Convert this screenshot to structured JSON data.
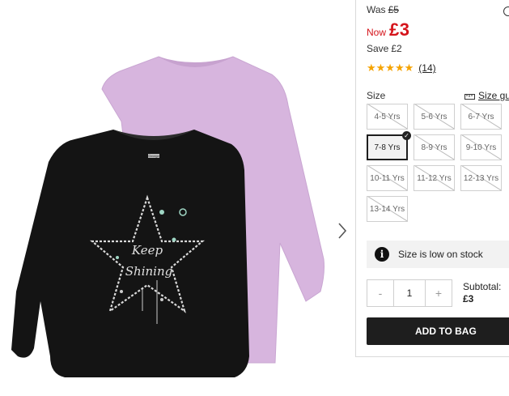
{
  "price": {
    "was_label": "Was",
    "was_value": "£5",
    "now_label": "Now",
    "now_value": "£3",
    "save_label": "Save",
    "save_value": "£2",
    "color": "#d5141b"
  },
  "rating": {
    "stars": "★★★★★",
    "review_count": "(14)",
    "star_color": "#f5a300"
  },
  "size": {
    "label": "Size",
    "guide_label": "Size gu",
    "options": [
      {
        "label": "4-5 Yrs",
        "state": "unavailable"
      },
      {
        "label": "5-6 Yrs",
        "state": "unavailable"
      },
      {
        "label": "6-7 Yrs",
        "state": "unavailable"
      },
      {
        "label": "7-8 Yrs",
        "state": "selected"
      },
      {
        "label": "8-9 Yrs",
        "state": "unavailable"
      },
      {
        "label": "9-10 Yrs",
        "state": "unavailable"
      },
      {
        "label": "10-11 Yrs",
        "state": "unavailable"
      },
      {
        "label": "11-12 Yrs",
        "state": "unavailable"
      },
      {
        "label": "12-13 Yrs",
        "state": "unavailable"
      },
      {
        "label": "13-14 Yrs",
        "state": "unavailable"
      }
    ]
  },
  "stock": {
    "message": "Size is low on stock",
    "icon": "info-icon"
  },
  "quantity": {
    "minus": "-",
    "value": "1",
    "plus": "+"
  },
  "subtotal": {
    "label": "Subtotal:",
    "value": "£3"
  },
  "cart": {
    "add_label": "ADD TO BAG"
  },
  "product_image": {
    "front_color": "#141414",
    "back_color": "#d7b5de",
    "print_text": "Keep Shining",
    "neck_label": "George"
  }
}
